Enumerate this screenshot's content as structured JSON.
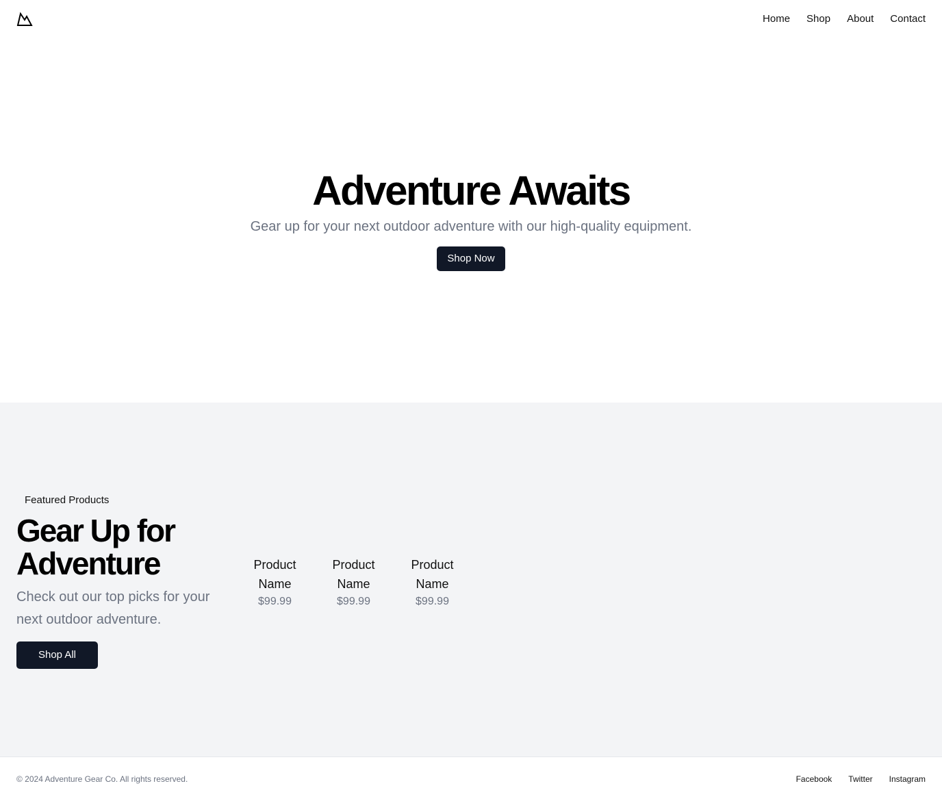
{
  "header": {
    "logo_icon": "mountain-icon",
    "nav": [
      "Home",
      "Shop",
      "About",
      "Contact"
    ]
  },
  "hero": {
    "title": "Adventure Awaits",
    "subtitle": "Gear up for your next outdoor adventure with our high-quality equipment.",
    "cta_label": "Shop Now"
  },
  "featured": {
    "label": "Featured Products",
    "title": "Gear Up for Adventure",
    "description": "Check out our top picks for your next outdoor adventure.",
    "cta_label": "Shop All",
    "products": [
      {
        "name": "Product Name",
        "price": "$99.99"
      },
      {
        "name": "Product Name",
        "price": "$99.99"
      },
      {
        "name": "Product Name",
        "price": "$99.99"
      }
    ]
  },
  "footer": {
    "copyright": "© 2024 Adventure Gear Co. All rights reserved.",
    "social": [
      "Facebook",
      "Twitter",
      "Instagram"
    ]
  },
  "colors": {
    "button_bg": "#111827",
    "section_bg": "#f3f4f6",
    "muted_text": "#6b7280"
  }
}
